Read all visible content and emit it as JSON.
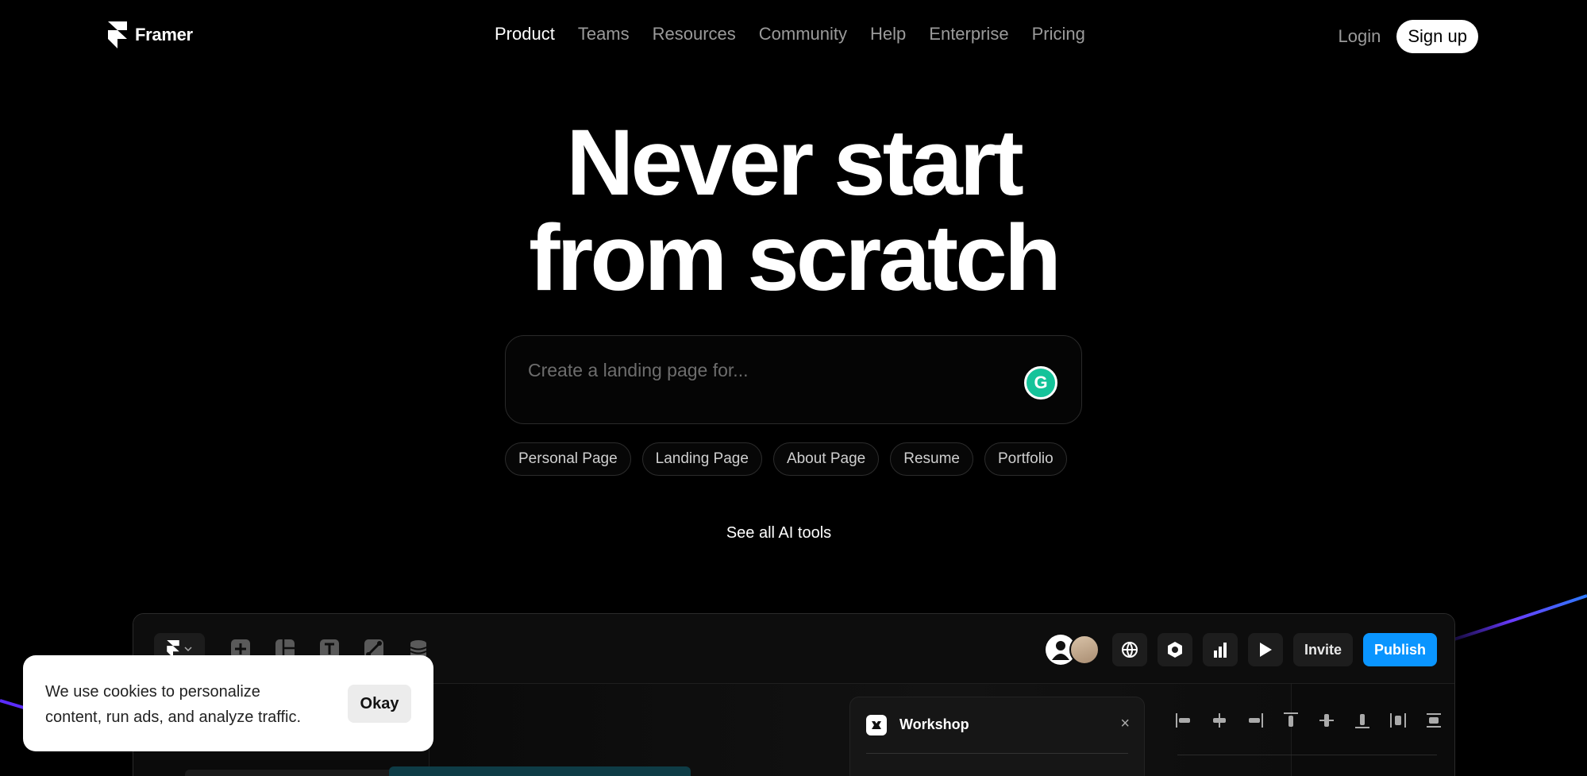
{
  "header": {
    "logo_text": "Framer",
    "menu": [
      "Product",
      "Teams",
      "Resources",
      "Community",
      "Help",
      "Enterprise",
      "Pricing"
    ],
    "login_label": "Login",
    "signup_label": "Sign up"
  },
  "hero": {
    "title_line1": "Never start",
    "title_line2": "from scratch",
    "prompt_placeholder": "Create a landing page for...",
    "assistant_icon": "G",
    "chips": [
      "Personal Page",
      "Landing Page",
      "About Page",
      "Resume",
      "Portfolio"
    ],
    "see_all_label": "See all AI tools"
  },
  "app_preview": {
    "toolbar_icons": [
      "framer-logo-icon",
      "chevron-down-icon",
      "insert-icon",
      "layout-icon",
      "text-icon",
      "vector-icon",
      "cms-icon"
    ],
    "right_icons": [
      "globe-icon",
      "hexagon-icon",
      "analytics-icon",
      "play-icon"
    ],
    "invite_label": "Invite",
    "publish_label": "Publish",
    "publish_color": "#0a95ff",
    "workshop_title": "Workshop",
    "close_glyph": "×",
    "align_icons": [
      "align-left-icon",
      "align-center-h-icon",
      "align-right-icon",
      "align-top-icon",
      "align-center-v-icon",
      "align-bottom-icon",
      "distribute-h-icon",
      "distribute-v-icon"
    ]
  },
  "cookie": {
    "text": "We use cookies to personalize content, run ads, and analyze traffic.",
    "okay_label": "Okay"
  }
}
